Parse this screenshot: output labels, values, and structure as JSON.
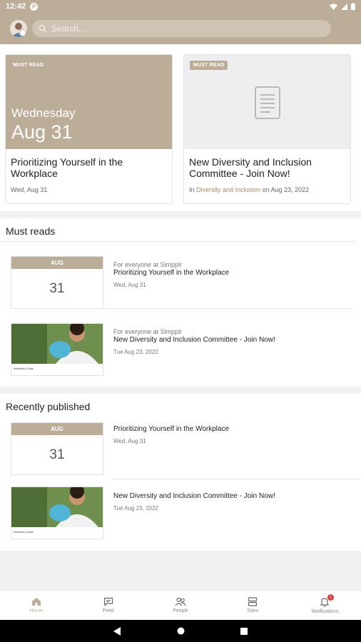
{
  "status_bar": {
    "time": "12:42",
    "app_badge": "P"
  },
  "header": {
    "search_placeholder": "Search..."
  },
  "featured": [
    {
      "badge": "MUST READ",
      "hero_day": "Wednesday",
      "hero_date": "Aug 31",
      "title": "Prioritizing Yourself in the Workplace",
      "meta": "Wed, Aug 31"
    },
    {
      "badge": "MUST READ",
      "title": "New Diversity and Inclusion Committee - Join Now!",
      "meta_prefix": "In ",
      "meta_link": "Diversity and Inclusion",
      "meta_suffix": " on Aug 23, 2022"
    }
  ],
  "must_reads": {
    "title": "Must reads",
    "items": [
      {
        "thumb_month": "AUG",
        "thumb_day": "31",
        "eyebrow": "For everyone at Simpplr",
        "title": "Prioritizing Yourself in the Workplace",
        "date": "Wed, Aug 31"
      },
      {
        "photo_caption": "Wellness Goals",
        "eyebrow": "For everyone at Simpplr",
        "title": "New Diversity and Inclusion Committee - Join Now!",
        "date": "Tue Aug 23, 2022"
      }
    ]
  },
  "recently_published": {
    "title": "Recently published",
    "items": [
      {
        "thumb_month": "AUG",
        "thumb_day": "31",
        "title": "Prioritizing Yourself in the Workplace",
        "date": "Wed, Aug 31"
      },
      {
        "photo_caption": "Wellness Goals",
        "title": "New Diversity and Inclusion Committee - Join Now!",
        "date": "Tue Aug 23, 2022"
      }
    ]
  },
  "tabs": [
    {
      "label": "Home",
      "icon": "home-icon",
      "active": true
    },
    {
      "label": "Feed",
      "icon": "feed-icon"
    },
    {
      "label": "People",
      "icon": "people-icon"
    },
    {
      "label": "Sites",
      "icon": "sites-icon"
    },
    {
      "label": "Notifications",
      "icon": "bell-icon",
      "badge": "1"
    }
  ],
  "colors": {
    "brand": "#bcad98",
    "link": "#a68b63",
    "badge_red": "#d93a3a"
  }
}
